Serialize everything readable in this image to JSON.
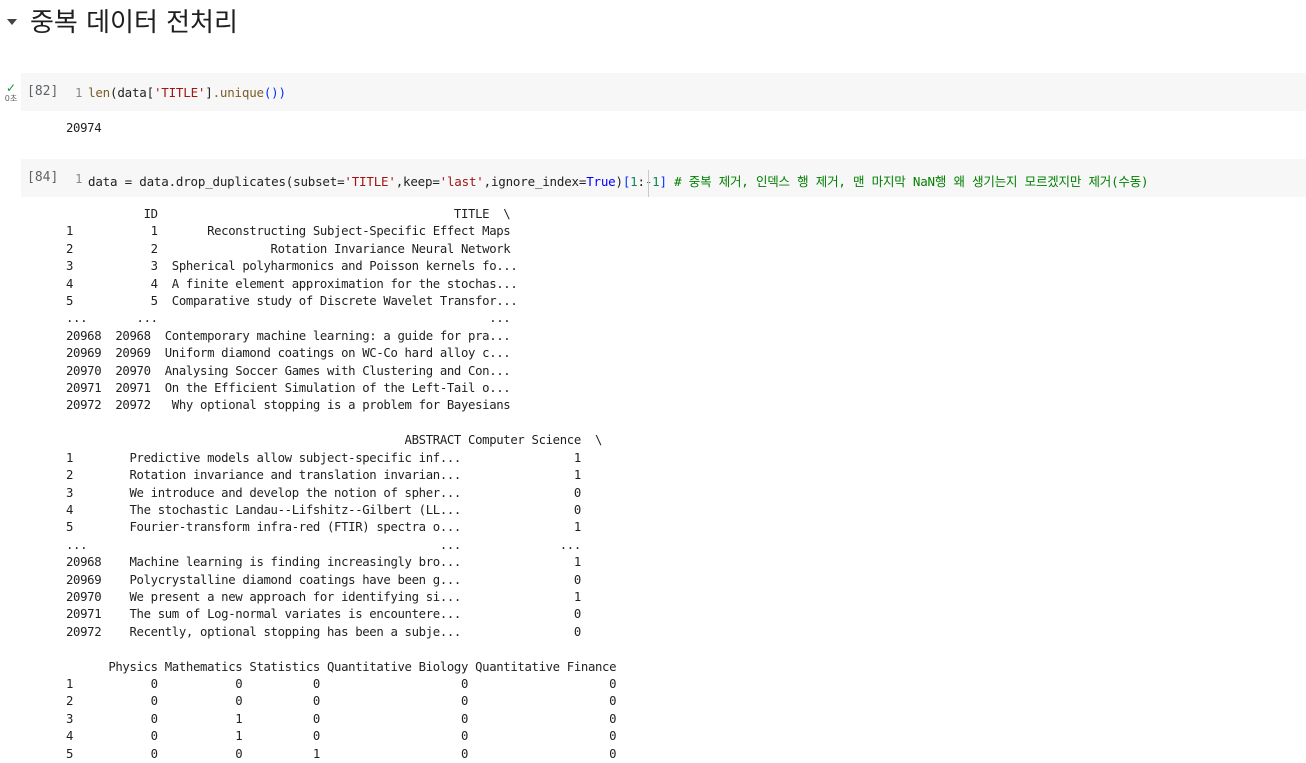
{
  "section": {
    "title": "중복 데이터 전처리"
  },
  "cell1": {
    "status_icon": "✓",
    "exec_time": "0초",
    "exec_count": "[82]",
    "line_number": "1",
    "code": {
      "fn": "len",
      "open1": "(",
      "var": "data",
      "open2": "[",
      "str": "'TITLE'",
      "close2": "]",
      "method": ".unique",
      "parens": "())",
      "close1": ")"
    },
    "output": "20974"
  },
  "cell2": {
    "exec_count": "[84]",
    "line_number": "1",
    "code": {
      "lhs": "data = data.drop_duplicates(subset=",
      "subset_val": "'TITLE'",
      "keep_kw": ",keep=",
      "keep_val": "'last'",
      "ignore_kw": ",ignore_index=",
      "ignore_val": "True",
      "close": ")",
      "slice_open": "[",
      "slice_start": "1",
      "slice_colon": ":",
      "slice_end": "-1",
      "slice_close": "]",
      "comment": " # 중복 제거, 인덱스 행 제거, 맨 마지막 NaN행 왜 생기는지 모르겠지만 제거(수동)"
    },
    "output_lines": [
      "           ID                                          TITLE  \\",
      "1           1       Reconstructing Subject-Specific Effect Maps",
      "2           2                Rotation Invariance Neural Network",
      "3           3  Spherical polyharmonics and Poisson kernels fo...",
      "4           4  A finite element approximation for the stochas...",
      "5           5  Comparative study of Discrete Wavelet Transfor...",
      "...       ...                                               ...",
      "20968  20968  Contemporary machine learning: a guide for pra...",
      "20969  20969  Uniform diamond coatings on WC-Co hard alloy c...",
      "20970  20970  Analysing Soccer Games with Clustering and Con...",
      "20971  20971  On the Efficient Simulation of the Left-Tail o...",
      "20972  20972   Why optional stopping is a problem for Bayesians",
      "",
      "                                                ABSTRACT Computer Science  \\",
      "1        Predictive models allow subject-specific inf...                1",
      "2        Rotation invariance and translation invarian...                1",
      "3        We introduce and develop the notion of spher...                0",
      "4        The stochastic Landau--Lifshitz--Gilbert (LL...                0",
      "5        Fourier-transform infra-red (FTIR) spectra o...                1",
      "...                                                  ...              ...",
      "20968    Machine learning is finding increasingly bro...                1",
      "20969    Polycrystalline diamond coatings have been g...                0",
      "20970    We present a new approach for identifying si...                1",
      "20971    The sum of Log-normal variates is encountere...                0",
      "20972    Recently, optional stopping has been a subje...                0",
      "",
      "      Physics Mathematics Statistics Quantitative Biology Quantitative Finance",
      "1           0           0          0                    0                    0",
      "2           0           0          0                    0                    0",
      "3           0           1          0                    0                    0",
      "4           0           1          0                    0                    0",
      "5           0           0          1                    0                    0"
    ]
  }
}
